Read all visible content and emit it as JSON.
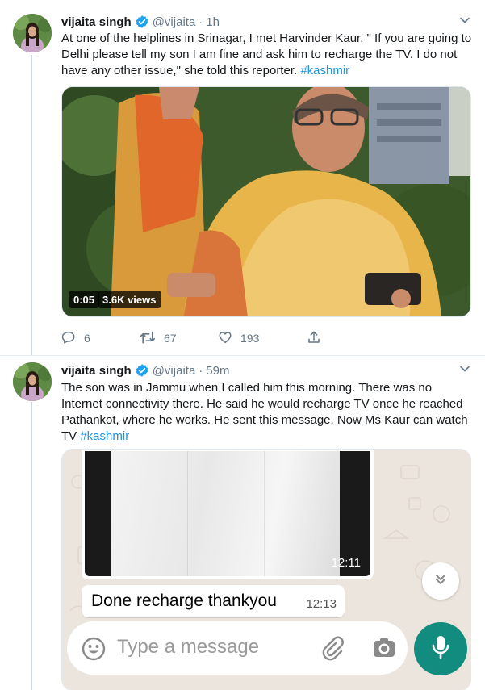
{
  "tweets": [
    {
      "name": "vijaita singh",
      "handle": "@vijaita",
      "separator": "·",
      "time": "1h",
      "text": "At one of the helplines in Srinagar, I met Harvinder Kaur. \" If you are going to Delhi please tell my son I am fine and ask him to recharge the TV. I do not have any other issue,\" she told this reporter.",
      "hashtag": "#kashmir",
      "video": {
        "duration": "0:05",
        "views": "3.6K views"
      },
      "actions": {
        "replies": "6",
        "retweets": "67",
        "likes": "193"
      }
    },
    {
      "name": "vijaita singh",
      "handle": "@vijaita",
      "separator": "·",
      "time": "59m",
      "text": "The son was in Jammu when I called him this morning. There was no Internet connectivity there. He said he would recharge TV once he reached Pathankot, where he works.  He sent this message. Now Ms Kaur can watch TV",
      "hashtag": "#kashmir",
      "whatsapp": {
        "photo_time": "12:11",
        "message": "Done recharge thankyou",
        "message_time": "12:13",
        "input_placeholder": "Type a message",
        "accent": "#128c7e",
        "wallpaper": "#ece5dd"
      }
    }
  ],
  "colors": {
    "verified": "#1da1f2",
    "link": "#1b95e0",
    "muted": "#657786"
  }
}
